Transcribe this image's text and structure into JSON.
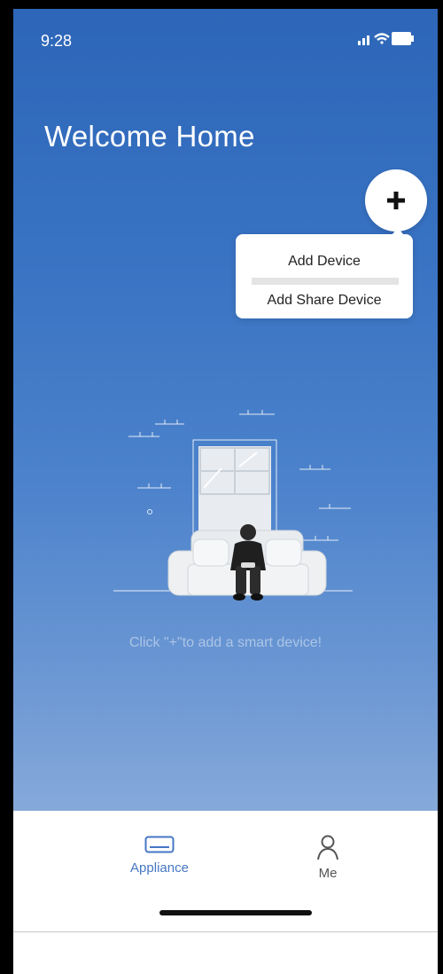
{
  "status": {
    "time": "9:28"
  },
  "header": {
    "title": "Welcome Home"
  },
  "add_menu": {
    "items": [
      "Add Device",
      "Add Share Device"
    ]
  },
  "empty_state": {
    "hint": "Click \"+\"to add a smart device!"
  },
  "tabs": [
    {
      "label": "Appliance",
      "icon": "air-conditioner-icon",
      "active": true
    },
    {
      "label": "Me",
      "icon": "person-icon",
      "active": false
    }
  ],
  "colors": {
    "accent": "#4677c4",
    "hero_top": "#2d66b8",
    "hero_bottom": "#86a9da"
  }
}
